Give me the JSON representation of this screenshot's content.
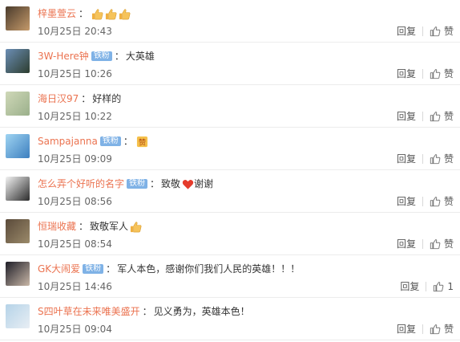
{
  "comments": [
    {
      "user": "梓墨萱云",
      "badge": "",
      "text": "",
      "emoji": [
        "thumbs-up",
        "thumbs-up",
        "thumbs-up"
      ],
      "time": "10月25日 20:43",
      "reply": "回复",
      "like": "赞",
      "avatar_colors": [
        "#4a3b2c",
        "#c59a6a"
      ]
    },
    {
      "user": "3W-Here钟",
      "badge": "铁粉",
      "text": "大英雄",
      "emoji": [],
      "time": "10月25日 10:26",
      "reply": "回复",
      "like": "赞",
      "avatar_colors": [
        "#6b8eb5",
        "#2d3d2f"
      ]
    },
    {
      "user": "海日汉97",
      "badge": "",
      "text": "好样的",
      "emoji": [],
      "time": "10月25日 10:22",
      "reply": "回复",
      "like": "赞",
      "avatar_colors": [
        "#cfd8b8",
        "#9bb08b"
      ]
    },
    {
      "user": "Sampajanna",
      "badge": "铁粉",
      "text": "",
      "emoji": [
        "zan"
      ],
      "time": "10月25日 09:09",
      "reply": "回复",
      "like": "赞",
      "avatar_colors": [
        "#9fd4f2",
        "#3d7fbf"
      ]
    },
    {
      "user": "怎么弄个好听的名字",
      "badge": "铁粉",
      "text": "致敬",
      "emoji": [
        "heart"
      ],
      "text2": "谢谢",
      "time": "10月25日 08:56",
      "reply": "回复",
      "like": "赞",
      "avatar_colors": [
        "#f3f3f3",
        "#2b2b2b"
      ]
    },
    {
      "user": "恒瑞收藏",
      "badge": "",
      "text": "致敬军人",
      "emoji": [
        "thumbs-up"
      ],
      "time": "10月25日 08:54",
      "reply": "回复",
      "like": "赞",
      "avatar_colors": [
        "#5a4a3a",
        "#9b8a6a"
      ]
    },
    {
      "user": "GK大闹爱",
      "badge": "铁粉",
      "text": "军人本色，感谢你们我们人民的英雄！！！",
      "emoji": [],
      "time": "10月25日 14:46",
      "reply": "回复",
      "like": "1",
      "avatar_colors": [
        "#1e1e28",
        "#c9b7a7"
      ]
    },
    {
      "user": "S四叶草在未来唯美盛开",
      "badge": "",
      "text": "见义勇为，英雄本色！",
      "emoji": [],
      "time": "10月25日 09:04",
      "reply": "回复",
      "like": "赞",
      "avatar_colors": [
        "#b5d3e8",
        "#e8eef4"
      ]
    }
  ],
  "colors": {
    "username": "#eb7350",
    "badge": "#7fb2e6",
    "text": "#333333",
    "meta": "#666666",
    "divider": "#ececec"
  }
}
